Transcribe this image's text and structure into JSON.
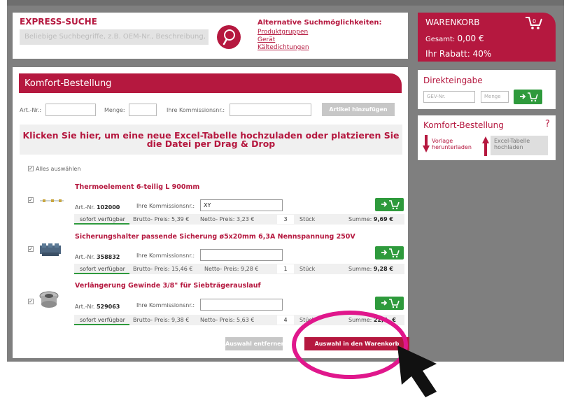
{
  "express": {
    "title": "EXPRESS-SUCHE",
    "placeholder": "Beliebige Suchbegriffe, z.B. OEM-Nr., Beschreibung,",
    "alt_title": "Alternative Suchmöglichkeiten:",
    "alt_links": [
      "Produktgruppen",
      "Gerät",
      "Kältedichtungen"
    ]
  },
  "cart": {
    "title": "WARENKORB",
    "total_label": "Gesamt:",
    "total_value": "0,00 €",
    "rabatt": "Ihr Rabatt: 40%"
  },
  "direct": {
    "title": "Direkteingabe",
    "gev_placeholder": "GEV-Nr.",
    "menge_placeholder": "Menge"
  },
  "kside": {
    "title": "Komfort-Bestellung",
    "help": "?",
    "vorlage": "Vorlage herunterladen",
    "excel": "Excel-Tabelle hochladen"
  },
  "komfort": {
    "title": "Komfort-Bestellung",
    "art_label": "Art.-Nr.:",
    "menge_label": "Menge:",
    "komm_label": "Ihre Kommissionsnr.:",
    "add_button": "Artikel hinzufügen",
    "upload_text": "Klicken Sie hier, um eine neue Excel-Tabelle hochzuladen oder platzieren Sie die Datei per Drag & Drop",
    "select_all": "Alles auswählen"
  },
  "items": [
    {
      "title": "Thermoelement 6-teilig L 900mm",
      "art_label": "Art.-Nr.",
      "art_no": "102000",
      "komm_label": "Ihre Kommissionsnr.:",
      "komm_value": "XY",
      "availability": "sofort verfügbar",
      "brutto": "Brutto- Preis: 5,39 €",
      "netto": "Netto- Preis: 3,23 €",
      "qty": "3",
      "unit": "Stück",
      "sum_label": "Summe:",
      "sum_value": "9,69 €"
    },
    {
      "title": "Sicherungshalter passende Sicherung ø5x20mm 6,3A Nennspannung 250V",
      "art_label": "Art.-Nr.",
      "art_no": "358832",
      "komm_label": "Ihre Kommissionsnr.:",
      "komm_value": "",
      "availability": "sofort verfügbar",
      "brutto": "Brutto- Preis: 15,46 €",
      "netto": "Netto- Preis: 9,28 €",
      "qty": "1",
      "unit": "Stück",
      "sum_label": "Summe:",
      "sum_value": "9,28 €"
    },
    {
      "title": "Verlängerung Gewinde 3/8\" für Siebträgerauslauf",
      "art_label": "Art.-Nr.",
      "art_no": "529063",
      "komm_label": "Ihre Kommissionsnr.:",
      "komm_value": "",
      "availability": "sofort verfügbar",
      "brutto": "Brutto- Preis: 9,38 €",
      "netto": "Netto- Preis: 5,63 €",
      "qty": "4",
      "unit": "Stück",
      "sum_label": "Summe:",
      "sum_value": "22,5_ €"
    }
  ],
  "actions": {
    "remove": "Auswahl entfernen",
    "add_to_cart": "Auswahl in den Warenkorb"
  },
  "colors": {
    "brand": "#b5183f",
    "green": "#2e9a3c",
    "highlight": "#e0178c"
  }
}
